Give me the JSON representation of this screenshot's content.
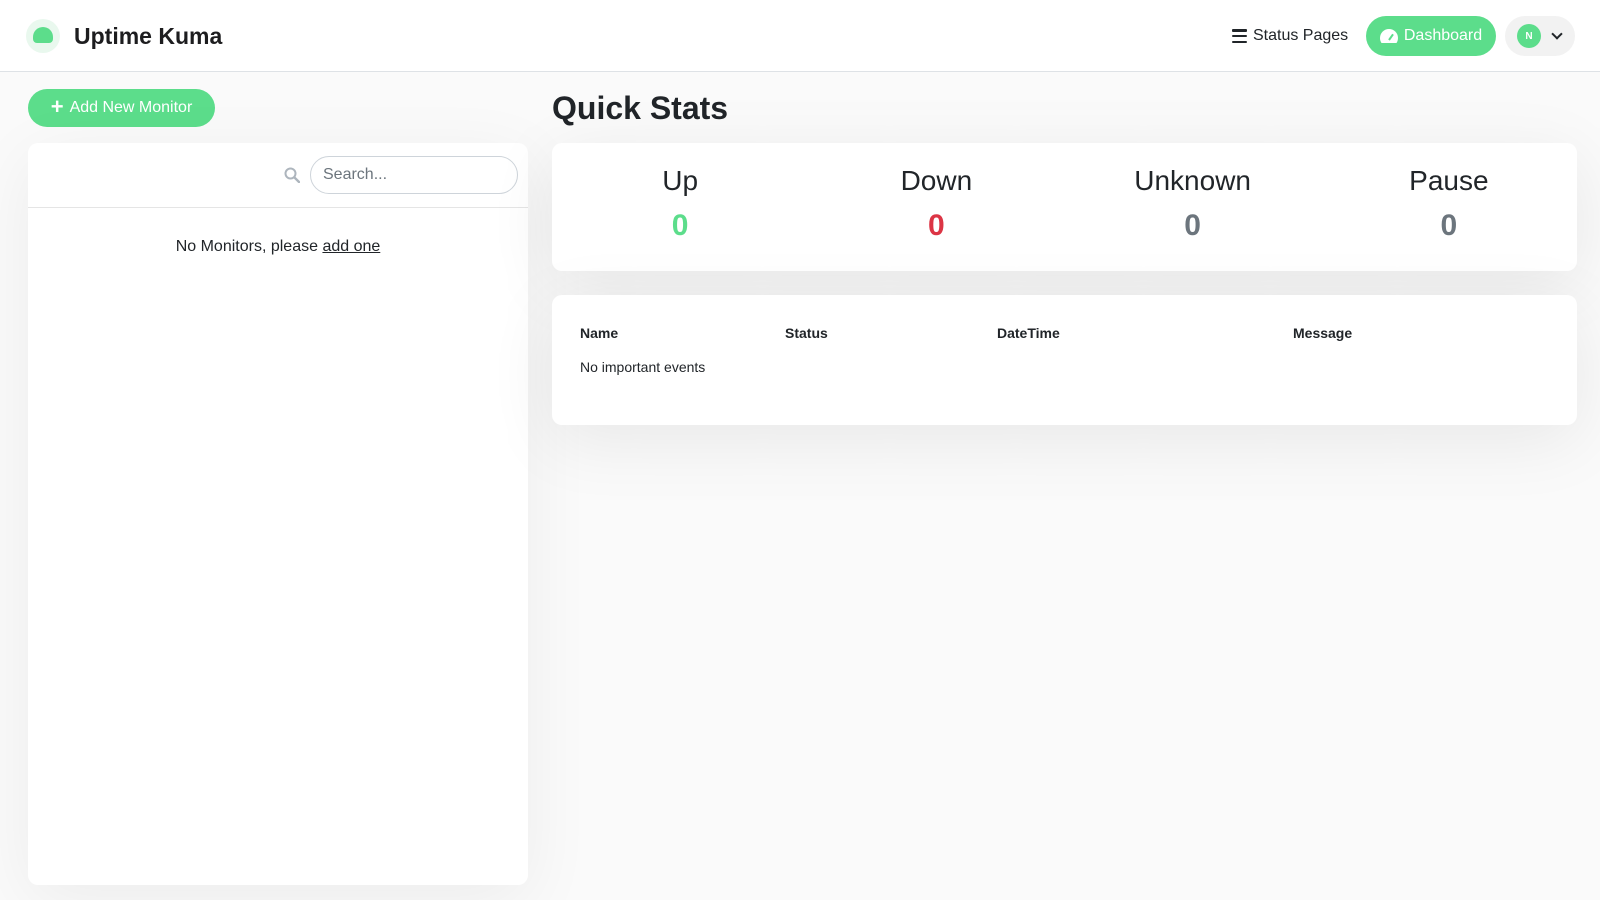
{
  "header": {
    "brand": "Uptime Kuma",
    "status_pages": "Status Pages",
    "dashboard": "Dashboard",
    "avatar_initial": "N"
  },
  "sidebar": {
    "add_button": "Add New Monitor",
    "search_placeholder": "Search...",
    "empty_text": "No Monitors, please ",
    "empty_link": "add one"
  },
  "main": {
    "title": "Quick Stats",
    "stats": [
      {
        "label": "Up",
        "value": "0",
        "color": "#5cdd8b"
      },
      {
        "label": "Down",
        "value": "0",
        "color": "#dc3545"
      },
      {
        "label": "Unknown",
        "value": "0",
        "color": "#6c757d"
      },
      {
        "label": "Pause",
        "value": "0",
        "color": "#6c757d"
      }
    ],
    "events": {
      "columns": [
        "Name",
        "Status",
        "DateTime",
        "Message"
      ],
      "empty": "No important events"
    }
  },
  "colors": {
    "primary": "#5cdd8b",
    "danger": "#dc3545",
    "muted": "#6c757d"
  }
}
